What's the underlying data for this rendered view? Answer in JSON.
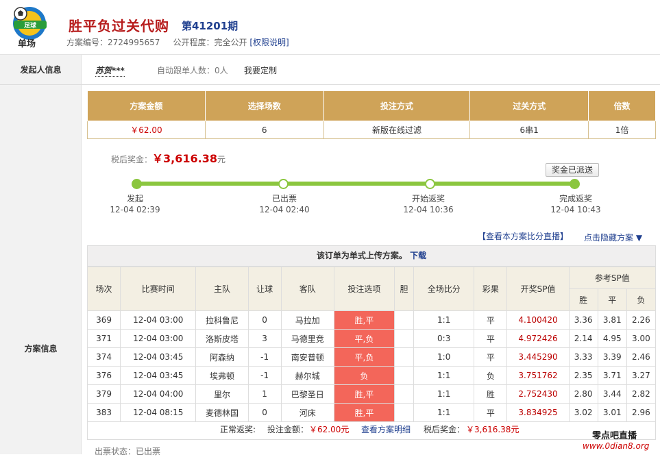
{
  "header": {
    "logo_text": "单场",
    "title": "胜平负过关代购",
    "period": "第41201期",
    "plan_no_label": "方案编号：",
    "plan_no": "2724995657",
    "visibility_label": "公开程度：",
    "visibility": "完全公开",
    "permission_link": "[权限说明]"
  },
  "left": {
    "initiator_label": "发起人信息",
    "plan_label": "方案信息"
  },
  "initiator": {
    "name": "苏贺***",
    "auto_follow": "自动跟单人数：0人",
    "custom": "我要定制"
  },
  "summary": {
    "headers": [
      "方案金额",
      "选择场数",
      "投注方式",
      "过关方式",
      "倍数"
    ],
    "values": [
      "￥62.00",
      "6",
      "新版在线过滤",
      "6串1",
      "1倍"
    ]
  },
  "tax": {
    "label": "税后奖金：",
    "amount": "￥3,616.38",
    "unit": "元"
  },
  "prize_sent": "奖金已派送",
  "progress": [
    {
      "label": "发起",
      "time": "12-04 02:39"
    },
    {
      "label": "已出票",
      "time": "12-04 02:40"
    },
    {
      "label": "开始返奖",
      "time": "12-04 10:36"
    },
    {
      "label": "完成返奖",
      "time": "12-04 10:43"
    }
  ],
  "links": {
    "live": "【查看本方案比分直播】",
    "hide": "点击隐藏方案 ▼"
  },
  "upload": {
    "text": "该订单为单式上传方案。",
    "download": "下载"
  },
  "games_table": {
    "headers": [
      "场次",
      "比赛时间",
      "主队",
      "让球",
      "客队",
      "投注选项",
      "胆",
      "全场比分",
      "彩果",
      "开奖SP值"
    ],
    "ref_header": "参考SP值",
    "ref_sub": [
      "胜",
      "平",
      "负"
    ],
    "rows": [
      [
        "369",
        "12-04 03:00",
        "拉科鲁尼",
        "0",
        "马拉加",
        "胜,平",
        "",
        "1:1",
        "平",
        "4.100420",
        "3.36",
        "3.81",
        "2.26"
      ],
      [
        "371",
        "12-04 03:00",
        "洛斯皮塔",
        "3",
        "马德里竞",
        "平,负",
        "",
        "0:3",
        "平",
        "4.972426",
        "2.14",
        "4.95",
        "3.00"
      ],
      [
        "374",
        "12-04 03:45",
        "阿森纳",
        "-1",
        "南安普顿",
        "平,负",
        "",
        "1:0",
        "平",
        "3.445290",
        "3.33",
        "3.39",
        "2.46"
      ],
      [
        "376",
        "12-04 03:45",
        "埃弗顿",
        "-1",
        "赫尔城",
        "负",
        "",
        "1:1",
        "负",
        "3.751762",
        "2.35",
        "3.71",
        "3.27"
      ],
      [
        "379",
        "12-04 04:00",
        "里尔",
        "1",
        "巴黎圣日",
        "胜,平",
        "",
        "1:1",
        "胜",
        "2.752430",
        "2.80",
        "3.44",
        "2.82"
      ],
      [
        "383",
        "12-04 08:15",
        "麦德林国",
        "0",
        "河床",
        "胜,平",
        "",
        "1:1",
        "平",
        "3.834925",
        "3.02",
        "3.01",
        "2.96"
      ]
    ]
  },
  "footer": {
    "normal_return": "正常返奖:",
    "bet_amount_label": "投注金额：",
    "bet_amount": "￥62.00元",
    "detail_link": "查看方案明细",
    "tax_label": "税后奖金：",
    "tax_amount": "￥3,616.38元"
  },
  "ticket_state": "出票状态：已出票",
  "watermark": {
    "line1": "零点吧直播",
    "line2": "www.0dian8.org"
  }
}
